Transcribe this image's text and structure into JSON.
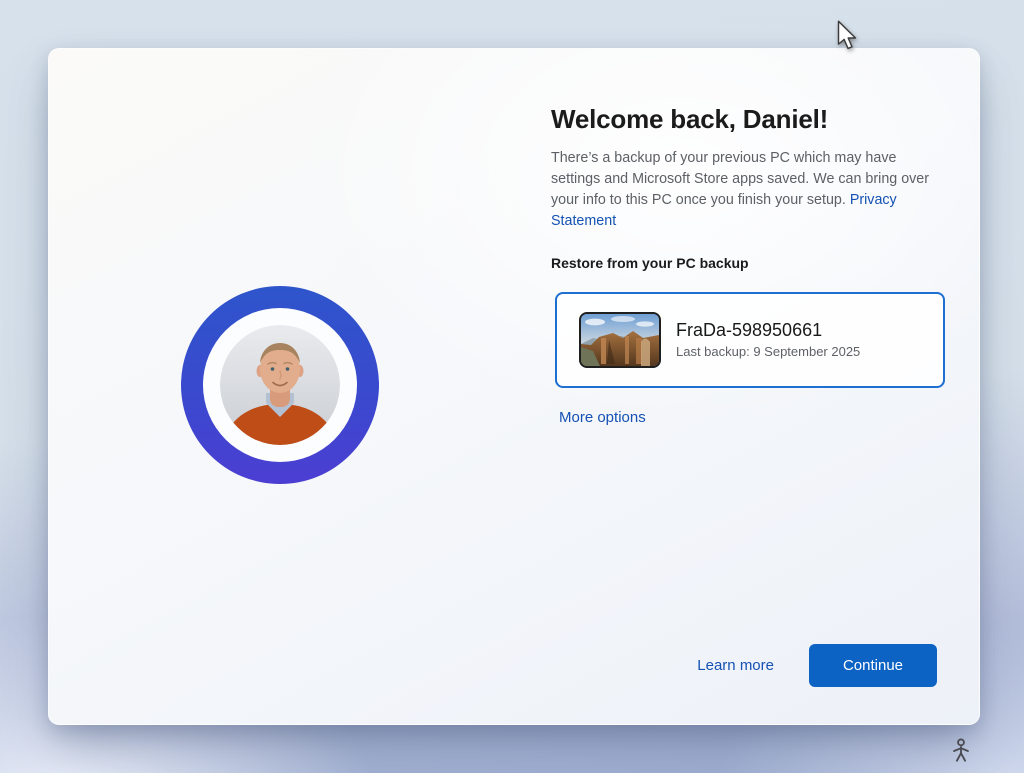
{
  "header": {
    "title": "Welcome back, Daniel!"
  },
  "intro": {
    "text": "There’s a backup of your previous PC which may have settings and Microsoft Store apps saved. We can bring over your info to this PC once you finish your setup.",
    "privacy_link": "Privacy Statement"
  },
  "restore": {
    "section_label": "Restore from your PC backup",
    "card": {
      "device_name": "FraDa-598950661",
      "last_backup": "Last backup: 9 September 2025"
    },
    "more_options": "More options"
  },
  "footer": {
    "learn_more": "Learn more",
    "continue_label": "Continue"
  },
  "icons": {
    "cursor": "arrow-pointer",
    "accessibility": "accessibility-person",
    "thumbnail": "landscape-photo-of-cliffs"
  },
  "colors": {
    "accent": "#0c63c4",
    "link": "#1552b4",
    "card_border": "#1e6fd2",
    "avatar_ring_top": "#2e55cb",
    "avatar_ring_bottom": "#4c3ed2",
    "background_top": "#d7e1eb",
    "background_bottom": "#9babcf"
  }
}
